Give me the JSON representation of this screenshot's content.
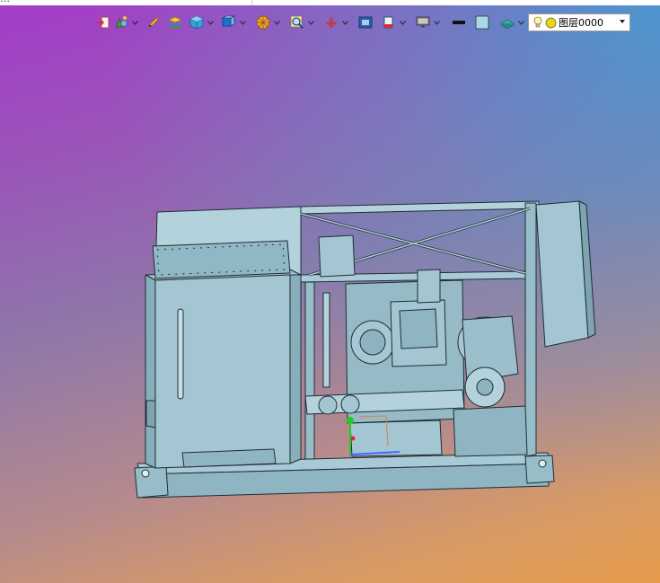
{
  "window": {
    "title_fragment": "…"
  },
  "toolbar": {
    "buttons": [
      {
        "name": "exit-icon",
        "has_dropdown": false
      },
      {
        "name": "snap-icon",
        "has_dropdown": true
      },
      {
        "name": "pencil-icon",
        "has_dropdown": false
      },
      {
        "name": "layer-stack-icon",
        "has_dropdown": false
      },
      {
        "name": "cube-icon",
        "has_dropdown": true
      },
      {
        "name": "view-cube-icon",
        "has_dropdown": true
      },
      {
        "name": "render-mode-icon",
        "has_dropdown": true
      },
      {
        "name": "zoom-icon",
        "has_dropdown": true
      },
      {
        "name": "axis-icon",
        "has_dropdown": true
      },
      {
        "name": "fit-view-icon",
        "has_dropdown": false
      },
      {
        "name": "section-icon",
        "has_dropdown": true
      },
      {
        "name": "monitor-icon",
        "has_dropdown": true
      },
      {
        "name": "line-weight-icon",
        "has_dropdown": false
      },
      {
        "name": "color-swatch-icon",
        "has_dropdown": false
      },
      {
        "name": "material-icon",
        "has_dropdown": true
      }
    ],
    "colors": {
      "accent_red": "#d32f2f",
      "accent_blue": "#1e6fd0",
      "accent_yellow": "#f2c531"
    }
  },
  "layer": {
    "current_layer": "图层0000"
  },
  "viewport": {
    "gradient_top": "#a43cc8",
    "gradient_bottom": "#e59a4a",
    "gradient_corner": "#40a0d2",
    "model_color": "#9bc0cc"
  }
}
